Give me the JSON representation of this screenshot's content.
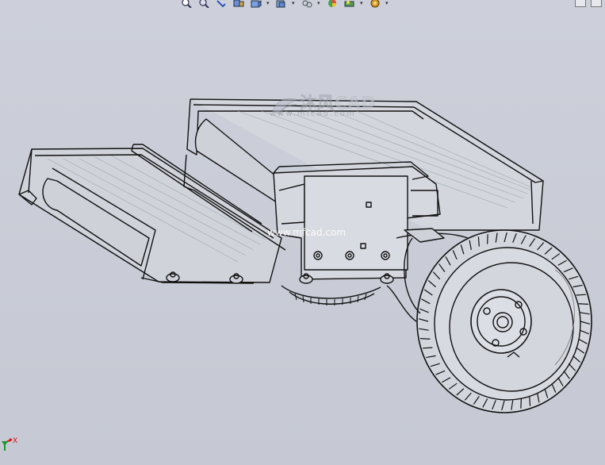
{
  "viewport": {
    "background": "#c9ccd6"
  },
  "toolbar": {
    "icons": [
      "zoom-to-fit-icon",
      "zoom-to-area-icon",
      "previous-view-icon",
      "section-view-icon",
      "view-orientation-icon",
      "display-style-icon",
      "hide-show-items-icon",
      "edit-appearance-icon",
      "apply-scene-icon",
      "view-settings-icon"
    ]
  },
  "watermark": {
    "title": "沐风CAD",
    "subtitle": "www.mfcad.com",
    "center_text": "www.mfcad.com"
  },
  "triad": {
    "axis_x_label": "X"
  }
}
